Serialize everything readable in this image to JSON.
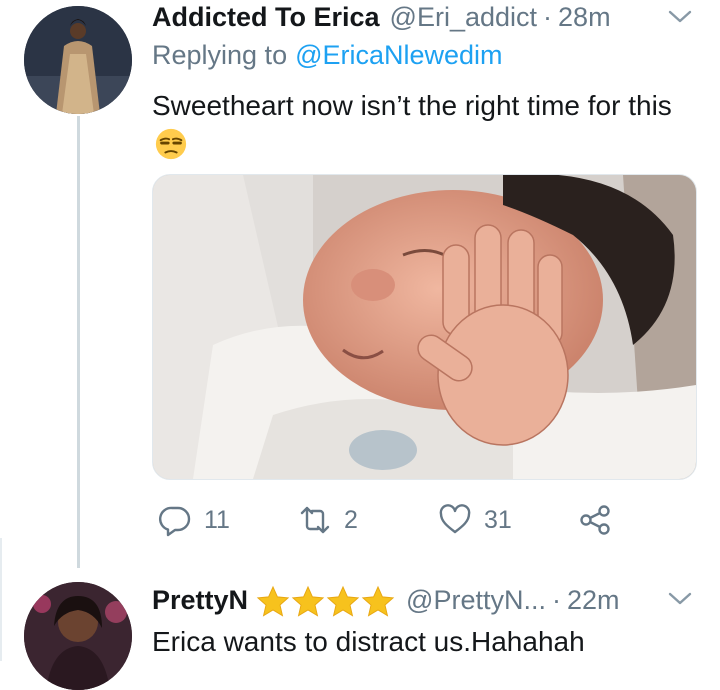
{
  "tweet1": {
    "author_name": "Addicted To Erica",
    "handle": "@Eri_addict",
    "separator": "·",
    "time": "28m",
    "replying_prefix": "Replying to",
    "replying_mention": "@EricaNlewedim",
    "text": "Sweetheart now isn’t the right time for this",
    "emoji": "unamused-face-emoji",
    "media": "photo-newborn-baby-hand-on-face",
    "actions": {
      "reply_count": "11",
      "retweet_count": "2",
      "like_count": "31"
    }
  },
  "tweet2": {
    "author_name": "PrettyN",
    "stars": [
      "star-emoji",
      "star-emoji",
      "star-emoji",
      "star-emoji"
    ],
    "handle": "@PrettyN...",
    "separator": "·",
    "time": "22m",
    "text": "Erica wants to distract us.Hahahah"
  },
  "colors": {
    "link": "#1da1f2",
    "secondary_text": "#657786",
    "thread_line": "#cfd9de",
    "star": "#f7c21d"
  }
}
